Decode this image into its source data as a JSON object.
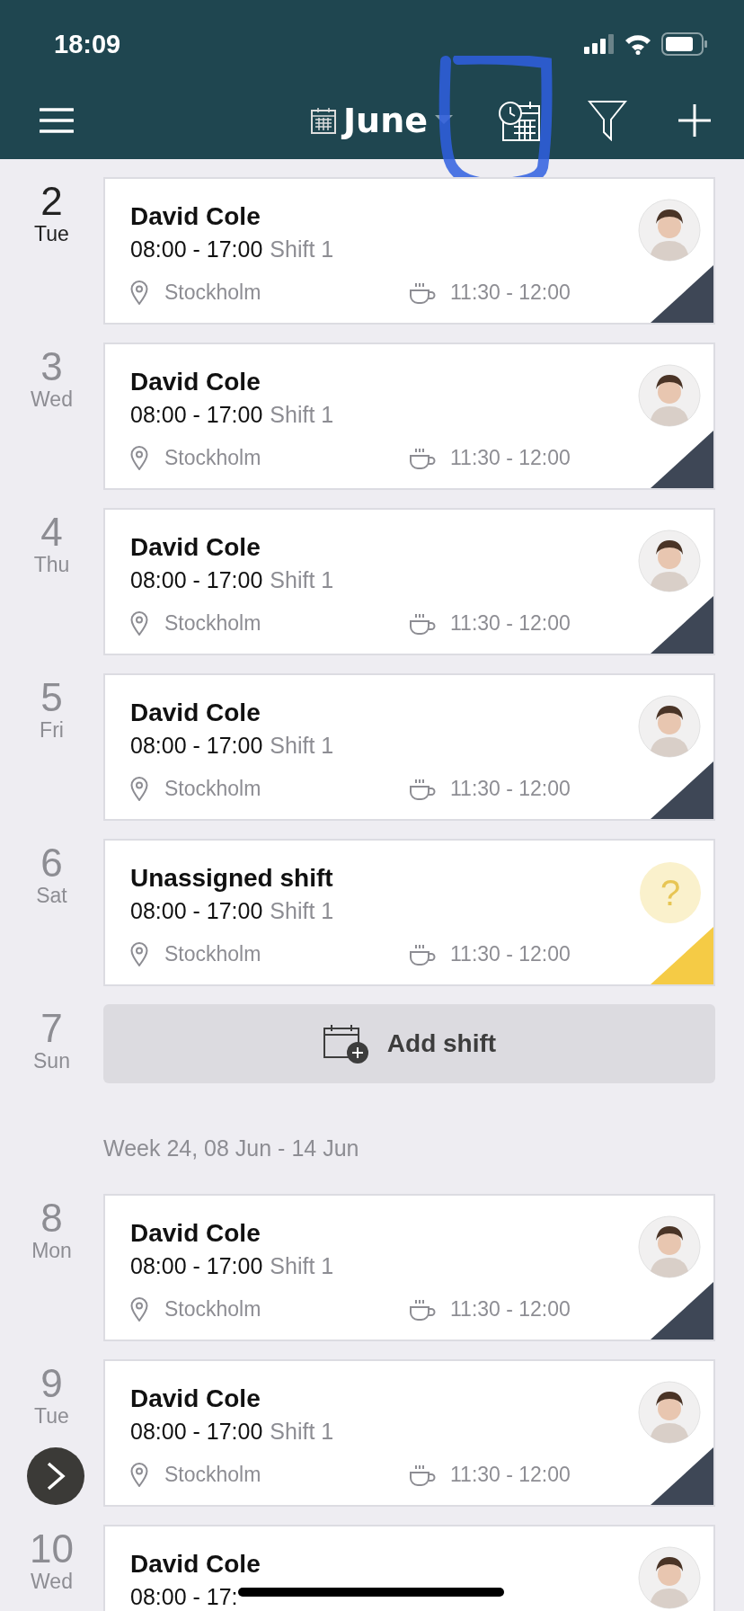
{
  "status_bar": {
    "time": "18:09"
  },
  "toolbar": {
    "month": "June"
  },
  "days": [
    {
      "kind": "shift",
      "number": "2",
      "weekday": "Tue",
      "today": true,
      "title": "David Cole",
      "time": "08:00 - 17:00",
      "shift": "Shift 1",
      "location": "Stockholm",
      "break": "11:30 - 12:00",
      "unassigned": false,
      "color": "#3e4756"
    },
    {
      "kind": "shift",
      "number": "3",
      "weekday": "Wed",
      "today": false,
      "title": "David Cole",
      "time": "08:00 - 17:00",
      "shift": "Shift 1",
      "location": "Stockholm",
      "break": "11:30 - 12:00",
      "unassigned": false,
      "color": "#3e4756"
    },
    {
      "kind": "shift",
      "number": "4",
      "weekday": "Thu",
      "today": false,
      "title": "David Cole",
      "time": "08:00 - 17:00",
      "shift": "Shift 1",
      "location": "Stockholm",
      "break": "11:30 - 12:00",
      "unassigned": false,
      "color": "#3e4756"
    },
    {
      "kind": "shift",
      "number": "5",
      "weekday": "Fri",
      "today": false,
      "title": "David Cole",
      "time": "08:00 - 17:00",
      "shift": "Shift 1",
      "location": "Stockholm",
      "break": "11:30 - 12:00",
      "unassigned": false,
      "color": "#3e4756"
    },
    {
      "kind": "shift",
      "number": "6",
      "weekday": "Sat",
      "today": false,
      "title": "Unassigned shift",
      "time": "08:00 - 17:00",
      "shift": "Shift 1",
      "location": "Stockholm",
      "break": "11:30 - 12:00",
      "unassigned": true,
      "avatar_text": "?",
      "color": "#f5cb45"
    },
    {
      "kind": "empty",
      "number": "7",
      "weekday": "Sun",
      "today": false,
      "label": "Add shift"
    },
    {
      "kind": "week",
      "label": "Week 24, 08 Jun - 14 Jun"
    },
    {
      "kind": "shift",
      "number": "8",
      "weekday": "Mon",
      "today": false,
      "title": "David Cole",
      "time": "08:00 - 17:00",
      "shift": "Shift 1",
      "location": "Stockholm",
      "break": "11:30 - 12:00",
      "unassigned": false,
      "color": "#3e4756"
    },
    {
      "kind": "shift",
      "number": "9",
      "weekday": "Tue",
      "today": false,
      "title": "David Cole",
      "time": "08:00 - 17:00",
      "shift": "Shift 1",
      "location": "Stockholm",
      "break": "11:30 - 12:00",
      "unassigned": false,
      "color": "#3e4756"
    },
    {
      "kind": "shift",
      "number": "10",
      "weekday": "Wed",
      "today": false,
      "title": "David Cole",
      "time": "08:00 - 17:",
      "unassigned": false
    }
  ]
}
